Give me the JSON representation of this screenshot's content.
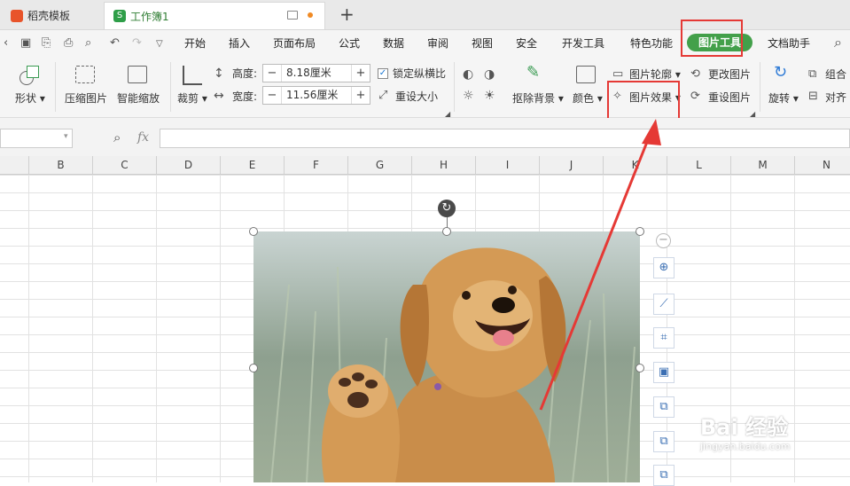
{
  "tabs": [
    {
      "title": "稻壳模板",
      "color": "#e8542a"
    },
    {
      "title": "工作簿1",
      "color": "#2e9e48"
    }
  ],
  "tab_add": "+",
  "menu": [
    "开始",
    "插入",
    "页面布局",
    "公式",
    "数据",
    "审阅",
    "视图",
    "安全",
    "开发工具",
    "特色功能",
    "图片工具",
    "文档助手"
  ],
  "ribbon": {
    "shape": "形状",
    "compress": "压缩图片",
    "smart_scale": "智能缩放",
    "crop": "裁剪",
    "height_label": "高度:",
    "height_value": "8.18厘米",
    "width_label": "宽度:",
    "width_value": "11.56厘米",
    "minus": "−",
    "plus": "+",
    "lock_ratio": "锁定纵横比",
    "reset_size": "重设大小",
    "remove_bg": "抠除背景",
    "color": "颜色",
    "outline": "图片轮廓",
    "effects": "图片效果",
    "change_pic": "更改图片",
    "reset_pic": "重设图片",
    "rotate": "旋转",
    "group": "组合",
    "align": "对齐"
  },
  "formula_fx": "fx",
  "columns": [
    "B",
    "C",
    "D",
    "E",
    "F",
    "G",
    "H",
    "I",
    "J",
    "K",
    "L",
    "M",
    "N"
  ],
  "watermark": {
    "brand": "Bai 经验",
    "url": "jingyan.baidu.com"
  },
  "colors": {
    "accent_green": "#43a04a",
    "highlight_red": "#e53935"
  }
}
